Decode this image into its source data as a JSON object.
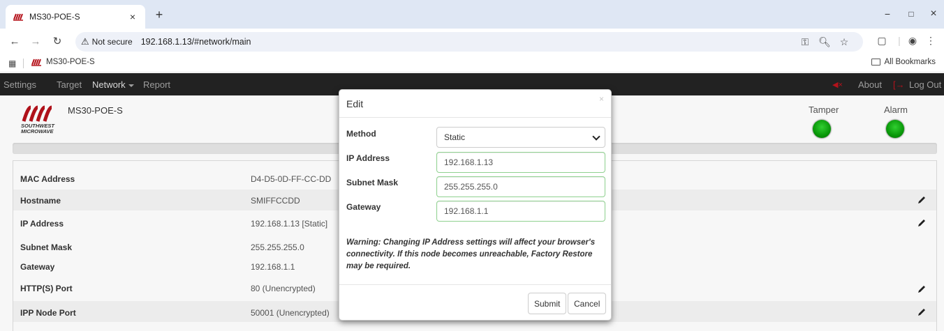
{
  "browser": {
    "tab_title": "MS30-POE-S",
    "tab_close": "×",
    "new_tab": "+",
    "window_controls": [
      "−",
      "□",
      "×"
    ],
    "security_label": "Not secure",
    "url": "192.168.1.13/#network/main",
    "bookmark_label": "MS30-POE-S",
    "all_bookmarks": "All Bookmarks"
  },
  "navbar": {
    "items": [
      "Settings",
      "Target",
      "Network",
      "Report"
    ],
    "right": {
      "about": "About",
      "logout": "Log Out"
    }
  },
  "header": {
    "device_name": "MS30-POE-S",
    "logo_text_line1": "SOUTHWEST",
    "logo_text_line2": "MICROWAVE",
    "tamper_label": "Tamper",
    "alarm_label": "Alarm",
    "led_color": "#1aa51a"
  },
  "table": {
    "rows": [
      {
        "label": "MAC Address",
        "value": "D4-D5-0D-FF-CC-DD",
        "editable": false
      },
      {
        "label": "Hostname",
        "value": "SMIFFCCDD",
        "editable": true
      },
      {
        "label": "IP Address",
        "value": "192.168.1.13 [Static]",
        "editable": true
      },
      {
        "label": "Subnet Mask",
        "value": "255.255.255.0",
        "editable": false
      },
      {
        "label": "Gateway",
        "value": "192.168.1.1",
        "editable": false
      },
      {
        "label": "HTTP(S) Port",
        "value": "80 (Unencrypted)",
        "editable": true
      },
      {
        "label": "IPP Node Port",
        "value": "50001 (Unencrypted)",
        "editable": true
      }
    ]
  },
  "modal": {
    "title": "Edit",
    "close": "×",
    "method_label": "Method",
    "method_value": "Static",
    "ip_label": "IP Address",
    "ip_value": "192.168.1.13",
    "subnet_label": "Subnet Mask",
    "subnet_value": "255.255.255.0",
    "gateway_label": "Gateway",
    "gateway_value": "192.168.1.1",
    "warning": "Warning: Changing IP Address settings will affect your browser's connectivity. If this node becomes unreachable, Factory Restore may be required.",
    "submit": "Submit",
    "cancel": "Cancel"
  },
  "colors": {
    "navbar_bg": "#222222",
    "brand_red": "#b5121b",
    "input_border_success": "#8fd18f"
  }
}
